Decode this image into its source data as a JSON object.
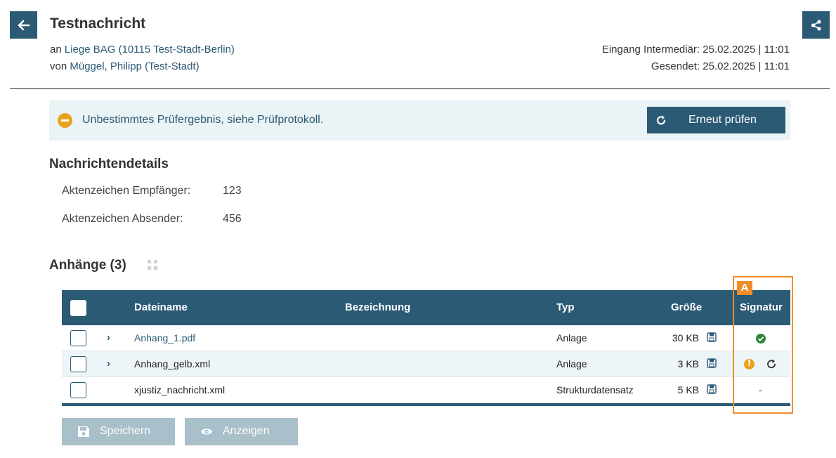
{
  "header": {
    "title": "Testnachricht",
    "an_prefix": "an",
    "an_name": "Liege BAG (10115 Test-Stadt-Berlin)",
    "von_prefix": "von",
    "von_name": "Müggel, Philipp (Test-Stadt)",
    "eingang": "Eingang Intermediär: 25.02.2025 | 11:01",
    "gesendet": "Gesendet: 25.02.2025 | 11:01"
  },
  "banner": {
    "message": "Unbestimmtes Prüfergebnis, siehe Prüfprotokoll.",
    "button_label": "Erneut prüfen"
  },
  "details": {
    "heading": "Nachrichtendetails",
    "rows": [
      {
        "label": "Aktenzeichen Empfänger:",
        "value": "123"
      },
      {
        "label": "Aktenzeichen Absender:",
        "value": "456"
      }
    ]
  },
  "attachments": {
    "heading": "Anhänge (3)",
    "columns": {
      "filename": "Dateiname",
      "bezeichnung": "Bezeichnung",
      "typ": "Typ",
      "groesse": "Größe",
      "signatur": "Signatur"
    },
    "rows": [
      {
        "filename": "Anhang_1.pdf",
        "bezeichnung": "",
        "typ": "Anlage",
        "size": "30 KB",
        "signature": "valid"
      },
      {
        "filename": "Anhang_gelb.xml",
        "bezeichnung": "",
        "typ": "Anlage",
        "size": "3 KB",
        "signature": "warning"
      },
      {
        "filename": "xjustiz_nachricht.xml",
        "bezeichnung": "",
        "typ": "Strukturdatensatz",
        "size": "5 KB",
        "signature": "-"
      }
    ]
  },
  "annotation": {
    "label": "A"
  },
  "footer": {
    "save_label": "Speichern",
    "view_label": "Anzeigen"
  },
  "icons": {
    "back": "arrow-left-icon",
    "share": "share-icon",
    "warning": "minus-circle-icon",
    "refresh": "refresh-icon",
    "expand": "expand-icon",
    "save": "floppy-disk-icon",
    "view": "eye-icon"
  },
  "colors": {
    "primary": "#2b5a75",
    "banner_bg": "#eaf3f5",
    "warning": "#e9a21d",
    "success": "#2e8540",
    "annotation": "#f08c2b",
    "disabled_button": "#a9bfc9"
  }
}
